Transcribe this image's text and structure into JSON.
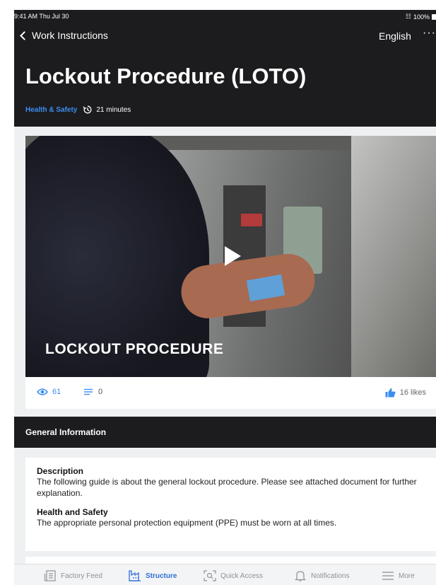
{
  "status_bar": {
    "time": "9:41 AM  Thu Jul 30",
    "battery": "100%"
  },
  "nav": {
    "back_label": "Work Instructions",
    "language": "English",
    "more": "···"
  },
  "page": {
    "title": "Lockout Procedure (LOTO)",
    "category": "Health & Safety",
    "duration": "21 minutes"
  },
  "video": {
    "caption": "LOCKOUT PROCEDURE"
  },
  "stats": {
    "views": "61",
    "comments": "0",
    "likes": "16 likes"
  },
  "general_information": {
    "heading": "General Information",
    "description_title": "Description",
    "description_text": "The following guide is about the general lockout procedure. Please see attached document for further explanation.",
    "health_title": "Health and Safety",
    "health_text": "The appropriate personal protection equipment (PPE) must be worn at all times."
  },
  "tabs": [
    {
      "label": "Factory Feed",
      "icon": "feed-icon",
      "active": false
    },
    {
      "label": "Structure",
      "icon": "factory-icon",
      "active": true
    },
    {
      "label": "Quick Access",
      "icon": "scan-icon",
      "active": false
    },
    {
      "label": "Notifications",
      "icon": "bell-icon",
      "active": false
    },
    {
      "label": "More",
      "icon": "menu-icon",
      "active": false
    }
  ],
  "colors": {
    "accent": "#3b8df0",
    "header_bg": "#1c1c1e",
    "active_tab": "#2d6fd8"
  }
}
